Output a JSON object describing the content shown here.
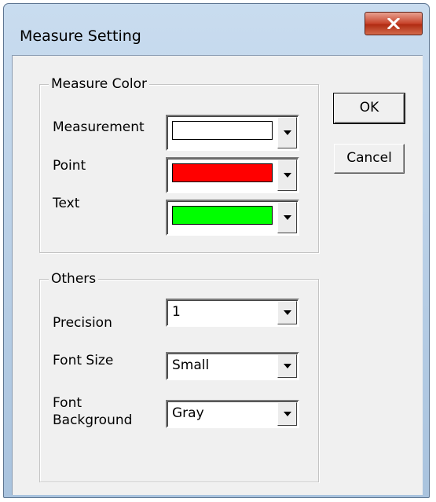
{
  "window": {
    "title": "Measure Setting",
    "close_icon": "close-icon"
  },
  "measure_color": {
    "legend": "Measure Color",
    "rows": [
      {
        "label": "Measurement",
        "color": "#ffffff"
      },
      {
        "label": "Point",
        "color": "#ff0000"
      },
      {
        "label": "Text",
        "color": "#00ff00"
      }
    ]
  },
  "others": {
    "legend": "Others",
    "precision": {
      "label": "Precision",
      "value": "1"
    },
    "font_size": {
      "label": "Font Size",
      "value": "Small"
    },
    "font_background": {
      "label_line1": "Font",
      "label_line2": "Background",
      "value": "Gray"
    }
  },
  "buttons": {
    "ok": "OK",
    "cancel": "Cancel"
  }
}
